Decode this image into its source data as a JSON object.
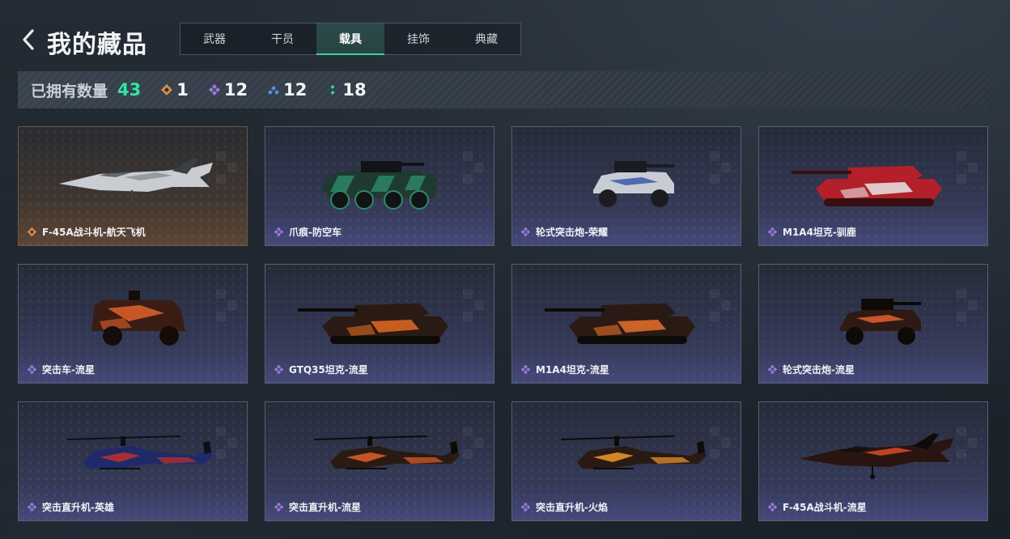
{
  "header": {
    "title": "我的藏品",
    "tabs": [
      {
        "label": "武器",
        "active": false
      },
      {
        "label": "干员",
        "active": false
      },
      {
        "label": "载具",
        "active": true
      },
      {
        "label": "挂饰",
        "active": false
      },
      {
        "label": "典藏",
        "active": false
      }
    ]
  },
  "stats": {
    "owned_label": "已拥有数量",
    "owned_count": "43",
    "tiers": [
      {
        "icon": "orange-diamond-icon",
        "color": "#d98a4a",
        "count": "1"
      },
      {
        "icon": "purple-diamond-icon",
        "color": "#9b7ae0",
        "count": "12"
      },
      {
        "icon": "blue-diamond-icon",
        "color": "#5a8fd6",
        "count": "12"
      },
      {
        "icon": "green-dots-icon",
        "color": "#35d5a0",
        "count": "18"
      }
    ]
  },
  "colors": {
    "accent": "#35d5a0",
    "legendary": "#d98a4a",
    "epic": "#9b7ae0"
  },
  "items": [
    {
      "name": "F-45A战斗机-航天飞机",
      "tier": "orange",
      "kind": "jet",
      "palette": [
        "#c9ccd0",
        "#8a8f96",
        "#3a3e44"
      ]
    },
    {
      "name": "爪痕-防空车",
      "tier": "purple",
      "kind": "apc",
      "palette": [
        "#1f3a30",
        "#2e8a6a",
        "#111416"
      ]
    },
    {
      "name": "轮式突击炮-荣耀",
      "tier": "purple",
      "kind": "buggy",
      "palette": [
        "#c8ccd4",
        "#3a58a8",
        "#1a1c20"
      ]
    },
    {
      "name": "M1A4坦克-驯鹿",
      "tier": "purple",
      "kind": "tank",
      "palette": [
        "#b3202a",
        "#e8e8e8",
        "#3a0e10"
      ]
    },
    {
      "name": "突击车-流星",
      "tier": "purple",
      "kind": "truck",
      "palette": [
        "#3a1c14",
        "#e0602a",
        "#140c0a"
      ]
    },
    {
      "name": "GTQ35坦克-流星",
      "tier": "purple",
      "kind": "tank",
      "palette": [
        "#2a1a14",
        "#e06a22",
        "#0e0a08"
      ]
    },
    {
      "name": "M1A4坦克-流星",
      "tier": "purple",
      "kind": "tank",
      "palette": [
        "#2a1a14",
        "#e8702a",
        "#0e0a08"
      ]
    },
    {
      "name": "轮式突击炮-流星",
      "tier": "purple",
      "kind": "buggy",
      "palette": [
        "#2e1a14",
        "#e0602a",
        "#0e0a08"
      ]
    },
    {
      "name": "突击直升机-英雄",
      "tier": "purple",
      "kind": "heli",
      "palette": [
        "#1e2a6a",
        "#c0302a",
        "#0e0e14"
      ]
    },
    {
      "name": "突击直升机-流星",
      "tier": "purple",
      "kind": "heli",
      "palette": [
        "#2a1a14",
        "#e0602a",
        "#0e0a08"
      ]
    },
    {
      "name": "突击直升机-火焰",
      "tier": "purple",
      "kind": "heli",
      "palette": [
        "#2a1a14",
        "#f09a2a",
        "#0e0a08"
      ]
    },
    {
      "name": "F-45A战斗机-流星",
      "tier": "purple",
      "kind": "jet",
      "palette": [
        "#2a1410",
        "#e0502a",
        "#0e0a08"
      ]
    }
  ]
}
